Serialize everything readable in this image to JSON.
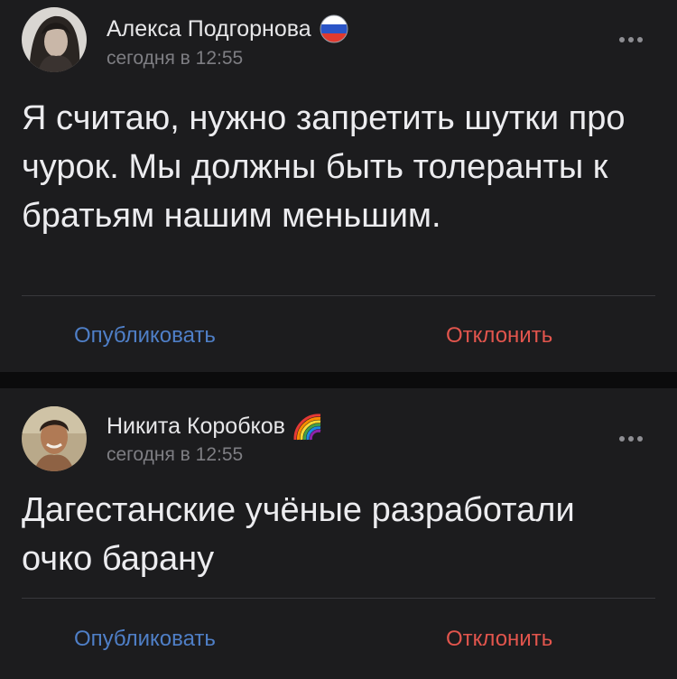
{
  "posts": [
    {
      "author": "Алекса Подгорнова",
      "badge_icon": "russian-flag-icon",
      "time": "сегодня в 12:55",
      "text": "Я считаю, нужно запретить шутки про чурок. Мы должны быть толеранты к братьям нашим меньшим.",
      "publish_label": "Опубликовать",
      "decline_label": "Отклонить"
    },
    {
      "author": "Никита Коробков",
      "badge_icon": "rainbow-icon",
      "time": "сегодня в 12:55",
      "text": "Дагестанские учёные разработали очко барану",
      "publish_label": "Опубликовать",
      "decline_label": "Отклонить"
    }
  ],
  "colors": {
    "background": "#0b0b0c",
    "card": "#1c1c1e",
    "publish": "#4f7fc7",
    "decline": "#e2554d",
    "secondary_text": "#7e7e83"
  }
}
